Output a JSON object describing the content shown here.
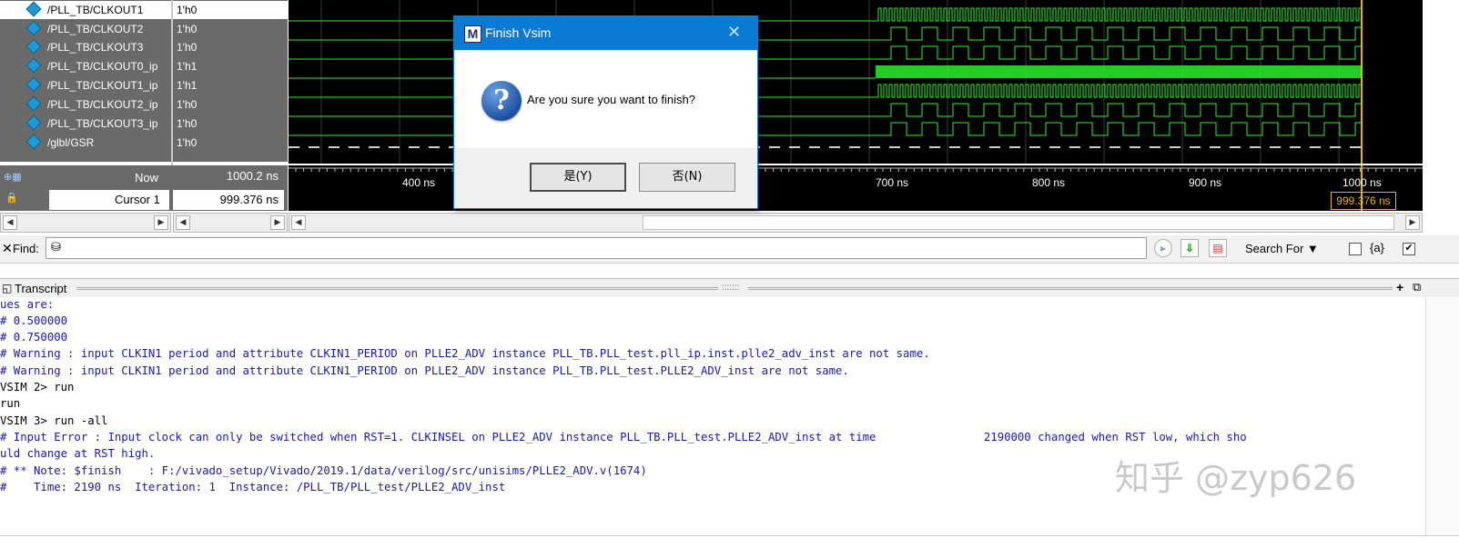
{
  "signals": [
    {
      "name": "/PLL_TB/CLKOUT1",
      "value": "1'h0",
      "selected": true
    },
    {
      "name": "/PLL_TB/CLKOUT2",
      "value": "1'h0",
      "selected": false
    },
    {
      "name": "/PLL_TB/CLKOUT3",
      "value": "1'h0",
      "selected": false
    },
    {
      "name": "/PLL_TB/CLKOUT0_ip",
      "value": "1'h1",
      "selected": false
    },
    {
      "name": "/PLL_TB/CLKOUT1_ip",
      "value": "1'h1",
      "selected": false
    },
    {
      "name": "/PLL_TB/CLKOUT2_ip",
      "value": "1'h0",
      "selected": false
    },
    {
      "name": "/PLL_TB/CLKOUT3_ip",
      "value": "1'h0",
      "selected": false
    },
    {
      "name": "/glbl/GSR",
      "value": "1'h0",
      "selected": false
    }
  ],
  "now_row": {
    "label": "Now",
    "value": "1000.2 ns"
  },
  "cursor_row": {
    "label": "Cursor 1",
    "value": "999.376 ns",
    "tag": "999.376 ns"
  },
  "ruler": {
    "ticks": [
      "400 ns",
      "700 ns",
      "800 ns",
      "900 ns",
      "1000 ns"
    ]
  },
  "colors": {
    "wave": "#2cf02c",
    "cursor": "#e7b600",
    "dialog_title": "#0b7ad3",
    "transcript_text": "#1a1aa8"
  },
  "find_bar": {
    "label": "Find:",
    "search_for": "Search For",
    "regex_label": "{a}"
  },
  "transcript": {
    "title": "Transcript",
    "lines": [
      {
        "text": "ues are:",
        "type": "out"
      },
      {
        "text": "# 0.500000",
        "type": "out"
      },
      {
        "text": "# 0.750000",
        "type": "out"
      },
      {
        "text": "# Warning : input CLKIN1 period and attribute CLKIN1_PERIOD on PLLE2_ADV instance PLL_TB.PLL_test.pll_ip.inst.plle2_adv_inst are not same.",
        "type": "out"
      },
      {
        "text": "# Warning : input CLKIN1 period and attribute CLKIN1_PERIOD on PLLE2_ADV instance PLL_TB.PLL_test.PLLE2_ADV_inst are not same.",
        "type": "out"
      },
      {
        "text": "VSIM 2> run",
        "type": "cmd"
      },
      {
        "text": "run",
        "type": "cmd"
      },
      {
        "text": "VSIM 3> run -all",
        "type": "cmd"
      },
      {
        "text": "# Input Error : Input clock can only be switched when RST=1. CLKINSEL on PLLE2_ADV instance PLL_TB.PLL_test.PLLE2_ADV_inst at time                2190000 changed when RST low, which sho",
        "type": "out"
      },
      {
        "text": "uld change at RST high.",
        "type": "out"
      },
      {
        "text": "# ** Note: $finish    : F:/vivado_setup/Vivado/2019.1/data/verilog/src/unisims/PLLE2_ADV.v(1674)",
        "type": "out"
      },
      {
        "text": "#    Time: 2190 ns  Iteration: 1  Instance: /PLL_TB/PLL_test/PLLE2_ADV_inst",
        "type": "out"
      }
    ]
  },
  "watermark": "知乎 @zyp626",
  "dialog": {
    "title": "Finish Vsim",
    "message": "Are you sure you want to finish?",
    "yes_label": "是(Y)",
    "no_label": "否(N)",
    "icon": "question-icon"
  }
}
